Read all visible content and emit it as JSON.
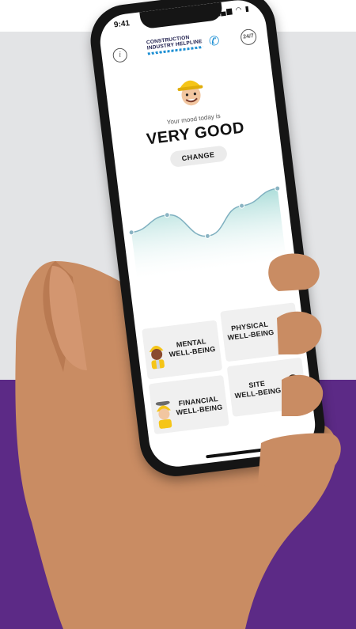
{
  "status_bar": {
    "time": "9:41",
    "icons": "▂▄▆ ◠ ▮"
  },
  "header": {
    "info_icon": "i",
    "brand_line1": "CONSTRUCTION",
    "brand_line2": "INDUSTRY HELPLINE",
    "sos_icon": "24/7",
    "phone_glyph": "✆"
  },
  "mood": {
    "label": "Your mood today is",
    "value": "VERY GOOD",
    "change_label": "CHANGE"
  },
  "chart_data": {
    "type": "area",
    "y": [
      3,
      4,
      2,
      4,
      5
    ],
    "point_labels": [
      "",
      "",
      "",
      "",
      ""
    ],
    "x_labels": [
      "",
      "",
      "",
      "",
      ""
    ]
  },
  "tiles": [
    {
      "line1": "MENTAL",
      "line2": "WELL-BEING"
    },
    {
      "line1": "PHYSICAL",
      "line2": "WELL-BEING"
    },
    {
      "line1": "FINANCIAL",
      "line2": "WELL-BEING"
    },
    {
      "line1": "SITE",
      "line2": "WELL-BEING"
    }
  ],
  "colors": {
    "top_background": "#e3e4e6",
    "bottom_background": "#5c2a86",
    "chart_fill": "#a9dcd8",
    "chart_line": "#7fb0c0",
    "hard_hat": "#f5c518",
    "brand_blue": "#1d8fd3"
  }
}
